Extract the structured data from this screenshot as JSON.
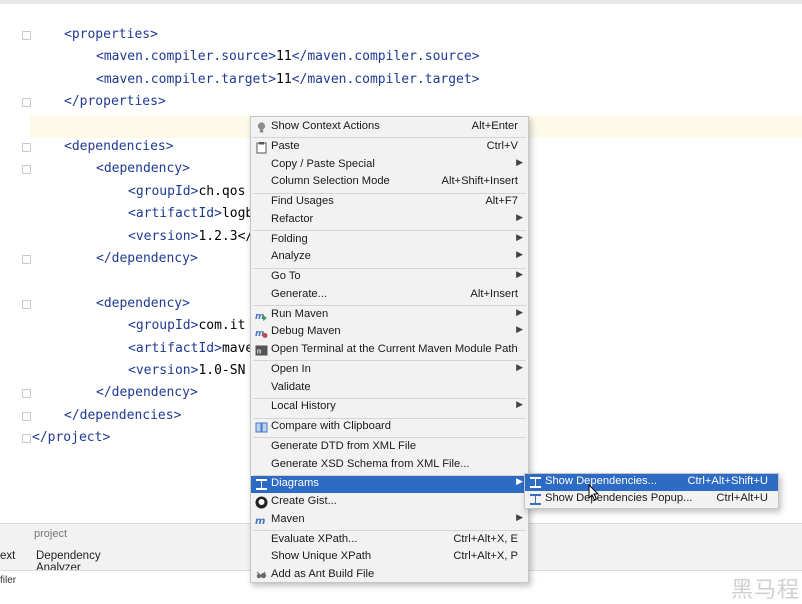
{
  "editor": {
    "lines": [
      {
        "indent": 0,
        "parts": [
          [
            "b",
            "<"
          ],
          [
            "t",
            "properties"
          ],
          [
            "b",
            ">"
          ]
        ]
      },
      {
        "indent": 1,
        "parts": [
          [
            "b",
            "<"
          ],
          [
            "t",
            "maven.compiler.source"
          ],
          [
            "b",
            ">"
          ],
          [
            "x",
            "11"
          ],
          [
            "b",
            "</"
          ],
          [
            "t",
            "maven.compiler.source"
          ],
          [
            "b",
            ">"
          ]
        ]
      },
      {
        "indent": 1,
        "parts": [
          [
            "b",
            "<"
          ],
          [
            "t",
            "maven.compiler.target"
          ],
          [
            "b",
            ">"
          ],
          [
            "x",
            "11"
          ],
          [
            "b",
            "</"
          ],
          [
            "t",
            "maven.compiler.target"
          ],
          [
            "b",
            ">"
          ]
        ]
      },
      {
        "indent": 0,
        "parts": [
          [
            "b",
            "</"
          ],
          [
            "t",
            "properties"
          ],
          [
            "b",
            ">"
          ]
        ]
      },
      {
        "indent": 0,
        "parts": []
      },
      {
        "indent": 0,
        "parts": [
          [
            "b",
            "<"
          ],
          [
            "t",
            "dependencies"
          ],
          [
            "b",
            ">"
          ]
        ]
      },
      {
        "indent": 1,
        "parts": [
          [
            "b",
            "<"
          ],
          [
            "t",
            "dependency"
          ],
          [
            "b",
            ">"
          ]
        ]
      },
      {
        "indent": 2,
        "parts": [
          [
            "b",
            "<"
          ],
          [
            "t",
            "groupId"
          ],
          [
            "b",
            ">"
          ],
          [
            "x",
            "ch.qos"
          ]
        ]
      },
      {
        "indent": 2,
        "parts": [
          [
            "b",
            "<"
          ],
          [
            "t",
            "artifactId"
          ],
          [
            "b",
            ">"
          ],
          [
            "x",
            "logb"
          ]
        ]
      },
      {
        "indent": 2,
        "parts": [
          [
            "b",
            "<"
          ],
          [
            "t",
            "version"
          ],
          [
            "b",
            ">"
          ],
          [
            "x",
            "1.2.3</"
          ]
        ]
      },
      {
        "indent": 1,
        "parts": [
          [
            "b",
            "</"
          ],
          [
            "t",
            "dependency"
          ],
          [
            "b",
            ">"
          ]
        ]
      },
      {
        "indent": 0,
        "parts": []
      },
      {
        "indent": 1,
        "parts": [
          [
            "b",
            "<"
          ],
          [
            "t",
            "dependency"
          ],
          [
            "b",
            ">"
          ]
        ]
      },
      {
        "indent": 2,
        "parts": [
          [
            "b",
            "<"
          ],
          [
            "t",
            "groupId"
          ],
          [
            "b",
            ">"
          ],
          [
            "x",
            "com.it"
          ]
        ]
      },
      {
        "indent": 2,
        "parts": [
          [
            "b",
            "<"
          ],
          [
            "t",
            "artifactId"
          ],
          [
            "b",
            ">"
          ],
          [
            "x",
            "mave"
          ]
        ]
      },
      {
        "indent": 2,
        "parts": [
          [
            "b",
            "<"
          ],
          [
            "t",
            "version"
          ],
          [
            "b",
            ">"
          ],
          [
            "x",
            "1.0-SN"
          ]
        ]
      },
      {
        "indent": 1,
        "parts": [
          [
            "b",
            "</"
          ],
          [
            "t",
            "dependency"
          ],
          [
            "b",
            ">"
          ]
        ]
      },
      {
        "indent": 0,
        "parts": [
          [
            "b",
            "</"
          ],
          [
            "t",
            "dependencies"
          ],
          [
            "b",
            ">"
          ]
        ]
      },
      {
        "indent": -1,
        "parts": [
          [
            "b",
            "</"
          ],
          [
            "t",
            "project"
          ],
          [
            "b",
            ">"
          ]
        ]
      }
    ]
  },
  "bottom_panel": {
    "project_label": "project",
    "tab_partial": "ext",
    "tab_dependency_analyzer": "Dependency Analyzer",
    "bottom_partial": "filer",
    "watermark": "黑马程"
  },
  "context_menu": {
    "items": [
      {
        "label": "Show Context Actions",
        "shortcut": "Alt+Enter",
        "icon": "bulb-icon",
        "submenu": false
      },
      {
        "sep": true
      },
      {
        "label": "Paste",
        "shortcut": "Ctrl+V",
        "icon": "clipboard-icon",
        "submenu": false
      },
      {
        "label": "Copy / Paste Special",
        "shortcut": "",
        "icon": "",
        "submenu": true
      },
      {
        "label": "Column Selection Mode",
        "shortcut": "Alt+Shift+Insert",
        "icon": "",
        "submenu": false
      },
      {
        "sep": true
      },
      {
        "label": "Find Usages",
        "shortcut": "Alt+F7",
        "icon": "",
        "submenu": false
      },
      {
        "label": "Refactor",
        "shortcut": "",
        "icon": "",
        "submenu": true
      },
      {
        "sep": true
      },
      {
        "label": "Folding",
        "shortcut": "",
        "icon": "",
        "submenu": true
      },
      {
        "label": "Analyze",
        "shortcut": "",
        "icon": "",
        "submenu": true
      },
      {
        "sep": true
      },
      {
        "label": "Go To",
        "shortcut": "",
        "icon": "",
        "submenu": true
      },
      {
        "label": "Generate...",
        "shortcut": "Alt+Insert",
        "icon": "",
        "submenu": false
      },
      {
        "sep": true
      },
      {
        "label": "Run Maven",
        "shortcut": "",
        "icon": "maven-run-icon",
        "submenu": true
      },
      {
        "label": "Debug Maven",
        "shortcut": "",
        "icon": "maven-debug-icon",
        "submenu": true
      },
      {
        "label": "Open Terminal at the Current Maven Module Path",
        "shortcut": "",
        "icon": "terminal-icon",
        "submenu": false
      },
      {
        "sep": true
      },
      {
        "label": "Open In",
        "shortcut": "",
        "icon": "",
        "submenu": true
      },
      {
        "label": "Validate",
        "shortcut": "",
        "icon": "",
        "submenu": false
      },
      {
        "sep": true
      },
      {
        "label": "Local History",
        "shortcut": "",
        "icon": "",
        "submenu": true
      },
      {
        "sep": true
      },
      {
        "label": "Compare with Clipboard",
        "shortcut": "",
        "icon": "compare-icon",
        "submenu": false
      },
      {
        "sep": true
      },
      {
        "label": "Generate DTD from XML File",
        "shortcut": "",
        "icon": "",
        "submenu": false
      },
      {
        "label": "Generate XSD Schema from XML File...",
        "shortcut": "",
        "icon": "",
        "submenu": false
      },
      {
        "sep": true
      },
      {
        "label": "Diagrams",
        "shortcut": "",
        "icon": "diagram-icon",
        "submenu": true,
        "selected": true
      },
      {
        "label": "Create Gist...",
        "shortcut": "",
        "icon": "github-icon",
        "submenu": false
      },
      {
        "label": "Maven",
        "shortcut": "",
        "icon": "maven-icon",
        "submenu": true
      },
      {
        "sep": true
      },
      {
        "label": "Evaluate XPath...",
        "shortcut": "Ctrl+Alt+X, E",
        "icon": "",
        "submenu": false
      },
      {
        "label": "Show Unique XPath",
        "shortcut": "Ctrl+Alt+X, P",
        "icon": "",
        "submenu": false
      },
      {
        "label": "Add as Ant Build File",
        "shortcut": "",
        "icon": "ant-icon",
        "submenu": false
      }
    ]
  },
  "diagrams_submenu": {
    "items": [
      {
        "label": "Show Dependencies...",
        "shortcut": "Ctrl+Alt+Shift+U",
        "icon": "diagram-icon",
        "selected": true
      },
      {
        "label": "Show Dependencies Popup...",
        "shortcut": "Ctrl+Alt+U",
        "icon": "diagram-icon",
        "selected": false
      }
    ]
  },
  "colors": {
    "tag": "#1f3a93",
    "selection": "#2e6bc4",
    "menu_bg": "#f2f2f2",
    "caret_row": "#fdfbe7"
  }
}
